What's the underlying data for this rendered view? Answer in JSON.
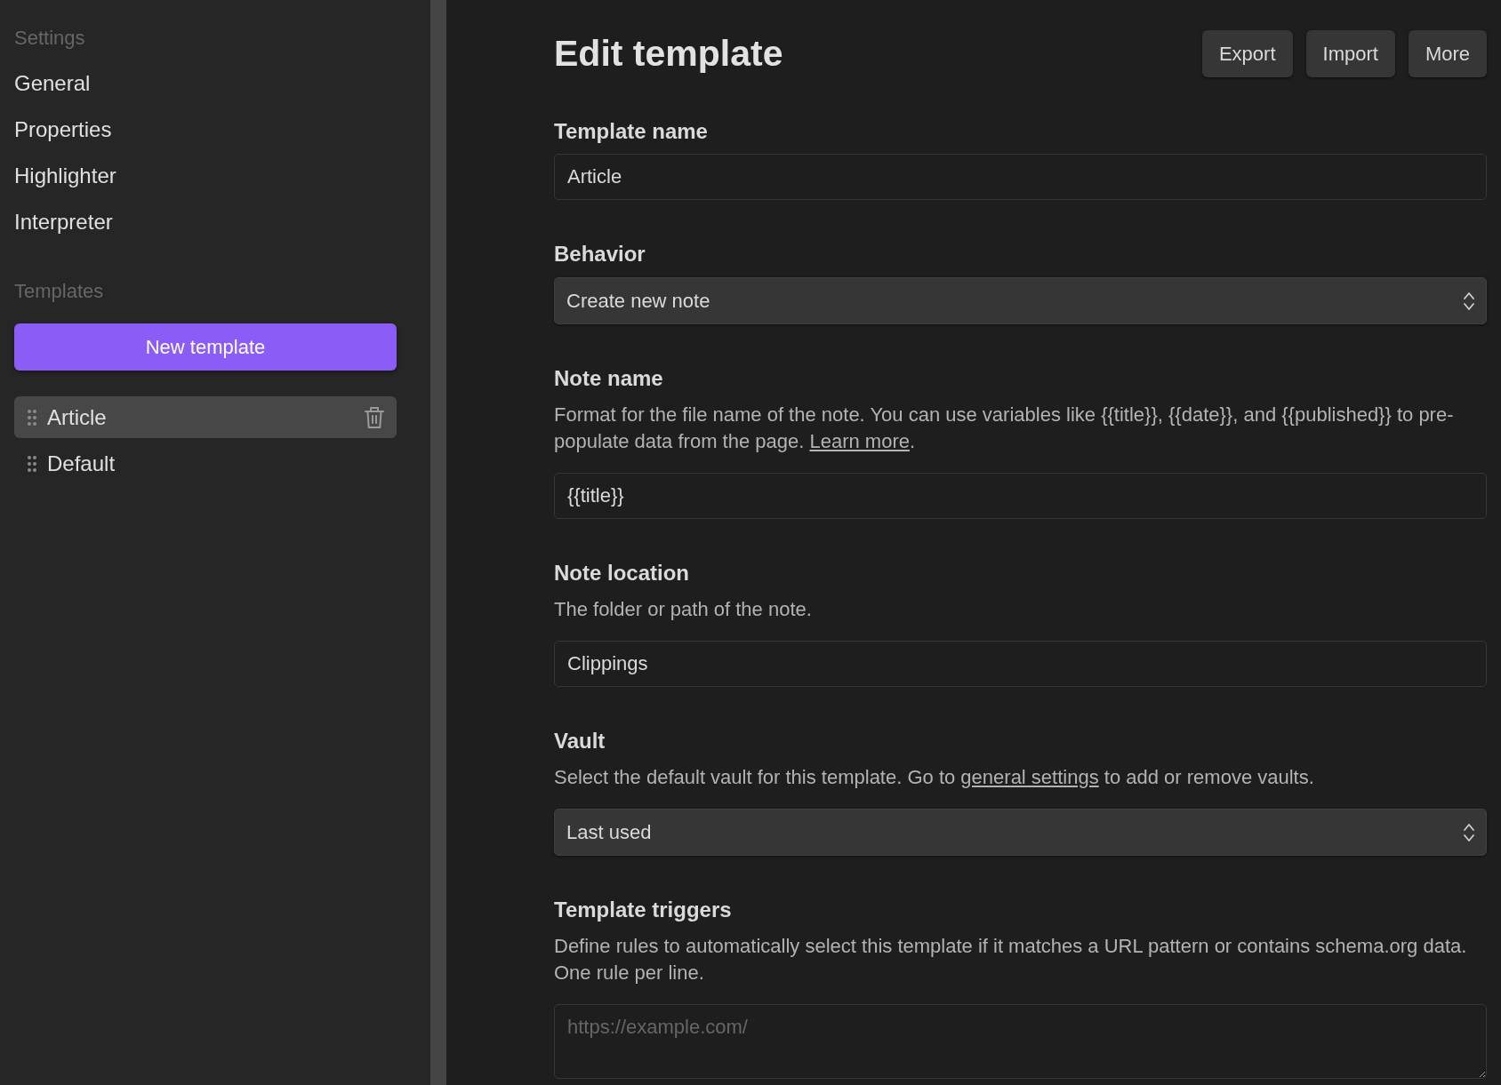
{
  "sidebar": {
    "settings": {
      "heading": "Settings",
      "items": [
        {
          "label": "General",
          "selected": false
        },
        {
          "label": "Properties",
          "selected": false
        },
        {
          "label": "Highlighter",
          "selected": false
        },
        {
          "label": "Interpreter",
          "selected": false
        }
      ]
    },
    "templates": {
      "heading": "Templates",
      "new_button": "New template",
      "items": [
        {
          "label": "Article",
          "selected": true
        },
        {
          "label": "Default",
          "selected": false
        }
      ]
    }
  },
  "editor": {
    "title": "Edit template",
    "actions": [
      "Export",
      "Import",
      "More"
    ],
    "fields": [
      {
        "kind": "input",
        "label": "Template name",
        "value": "Article"
      },
      {
        "kind": "select",
        "label": "Behavior",
        "value": "Create new note"
      },
      {
        "kind": "input",
        "label": "Note name",
        "description": {
          "before": "Format for the file name of the note. You can use variables like {{title}}, {{date}}, and {{published}} to pre-populate data from the page. ",
          "link": "Learn more",
          "after": "."
        },
        "value": "{{title}}"
      },
      {
        "kind": "input",
        "label": "Note location",
        "description": {
          "before": "The folder or path of the note."
        },
        "value": "Clippings"
      },
      {
        "kind": "select",
        "label": "Vault",
        "description": {
          "before": "Select the default vault for this template. Go to ",
          "link": "general settings",
          "after": " to add or remove vaults."
        },
        "value": "Last used"
      },
      {
        "kind": "textarea",
        "label": "Template triggers",
        "description": {
          "before": "Define rules to automatically select this template if it matches a URL pattern or contains schema.org data. One rule per line."
        },
        "placeholder": "https://example.com/"
      }
    ]
  }
}
